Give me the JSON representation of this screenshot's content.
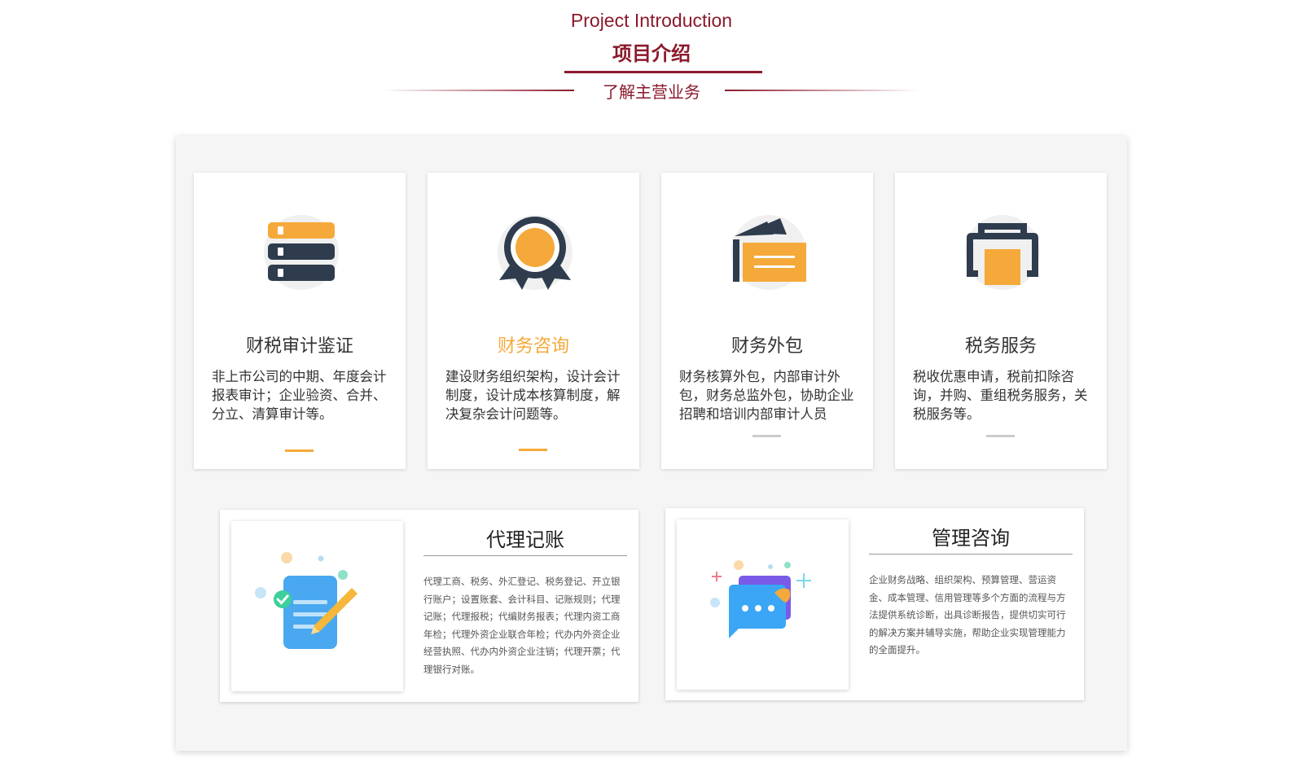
{
  "header": {
    "title_en": "Project Introduction",
    "title_cn": "项目介绍",
    "subtitle": "了解主营业务"
  },
  "colors": {
    "brand": "#8b1a2b",
    "accent": "#f5a93a",
    "navy": "#2e3c4e"
  },
  "cards": [
    {
      "icon": "server-icon",
      "title": "财税审计鉴证",
      "desc": "非上市公司的中期、年度会计报表审计；企业验资、合并、分立、清算审计等。"
    },
    {
      "icon": "award-icon",
      "title": "财务咨询",
      "desc": "建设财务组织架构，设计会计制度，设计成本核算制度，解决复杂会计问题等。"
    },
    {
      "icon": "folder-icon",
      "title": "财务外包",
      "desc": "财务核算外包，内部审计外包，财务总监外包，协助企业招聘和培训内部审计人员"
    },
    {
      "icon": "printer-icon",
      "title": "税务服务",
      "desc": "税收优惠申请，税前扣除咨询，并购、重组税务服务，关税服务等。"
    }
  ],
  "wide": [
    {
      "icon": "document-pen-icon",
      "title": "代理记账",
      "desc": "代理工商、税务、外汇登记、税务登记、开立银行账户；设置账套、会计科目、记账规则；代理记账；代理报税；代编财务报表；代理内资工商年检；代理外资企业联合年检；代办内外资企业经营执照、代办内外资企业注销；代理开票；代理银行对账。"
    },
    {
      "icon": "chat-bubble-icon",
      "title": "管理咨询",
      "desc": "企业财务战略、组织架构、预算管理、营运资金、成本管理、信用管理等多个方面的流程与方法提供系统诊断，出具诊断报告，提供切实可行的解决方案并辅导实施，帮助企业实现管理能力的全面提升。"
    }
  ]
}
